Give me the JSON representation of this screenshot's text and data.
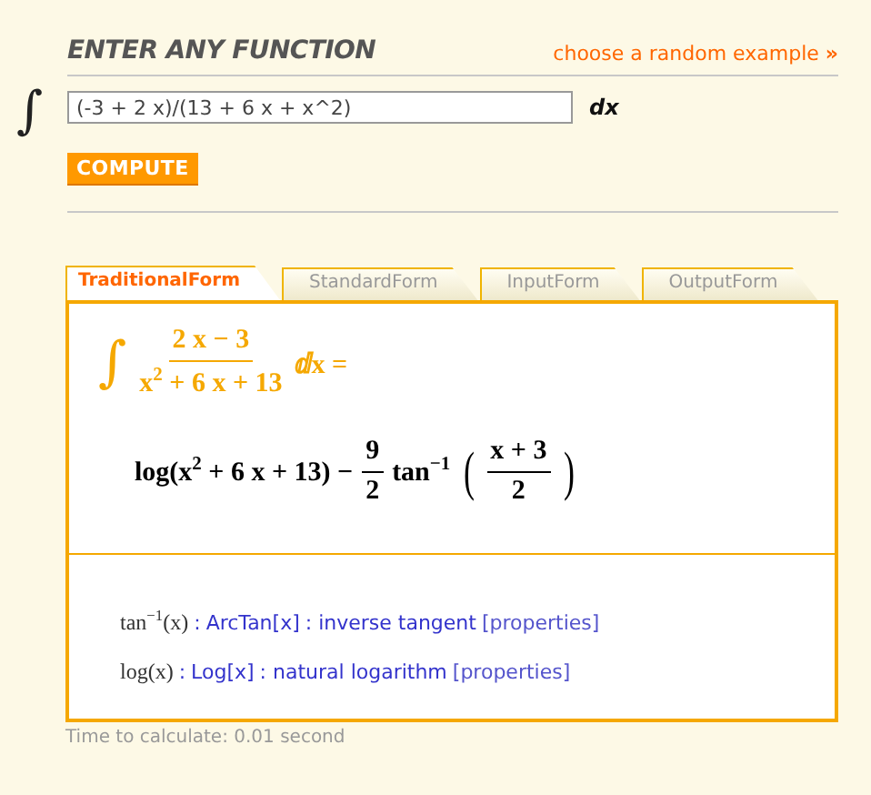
{
  "header": {
    "title": "ENTER ANY FUNCTION",
    "random_link": "choose a random example",
    "random_arrow": "»"
  },
  "input": {
    "integral_sign": "∫",
    "value": "(-3 + 2 x)/(13 + 6 x + x^2)",
    "differential": "dx"
  },
  "compute_button": "COMPUTE",
  "tabs": [
    {
      "label": "TraditionalForm",
      "selected": true
    },
    {
      "label": "StandardForm",
      "selected": false
    },
    {
      "label": "InputForm",
      "selected": false
    },
    {
      "label": "OutputForm",
      "selected": false
    }
  ],
  "integral": {
    "sign": "∫",
    "numerator": "2 x − 3",
    "denominator": "x$^{2}$ + 6 x + 13",
    "tail": "ⅆx ="
  },
  "result": [
    {
      "kind": "text",
      "text": "log(x$^{2}$ + 6 x + 13) −"
    },
    {
      "kind": "fraction",
      "numerator": "9",
      "denominator": "2"
    },
    {
      "kind": "text",
      "text": "tan$^{−1}$"
    },
    {
      "kind": "paren",
      "text": "("
    },
    {
      "kind": "fraction",
      "numerator": "x + 3",
      "denominator": "2"
    },
    {
      "kind": "paren",
      "text": ")"
    }
  ],
  "notes": [
    {
      "math": "tan$^{−1}$(x)",
      "separator": ":",
      "function_link": "ArcTan[x]",
      "description": ": inverse tangent",
      "properties_link": "[properties]"
    },
    {
      "math": "log(x)",
      "separator": ":",
      "function_link": "Log[x]",
      "description": ": natural logarithm",
      "properties_link": "[properties]"
    }
  ],
  "timing": "Time to calculate: 0.01 second"
}
